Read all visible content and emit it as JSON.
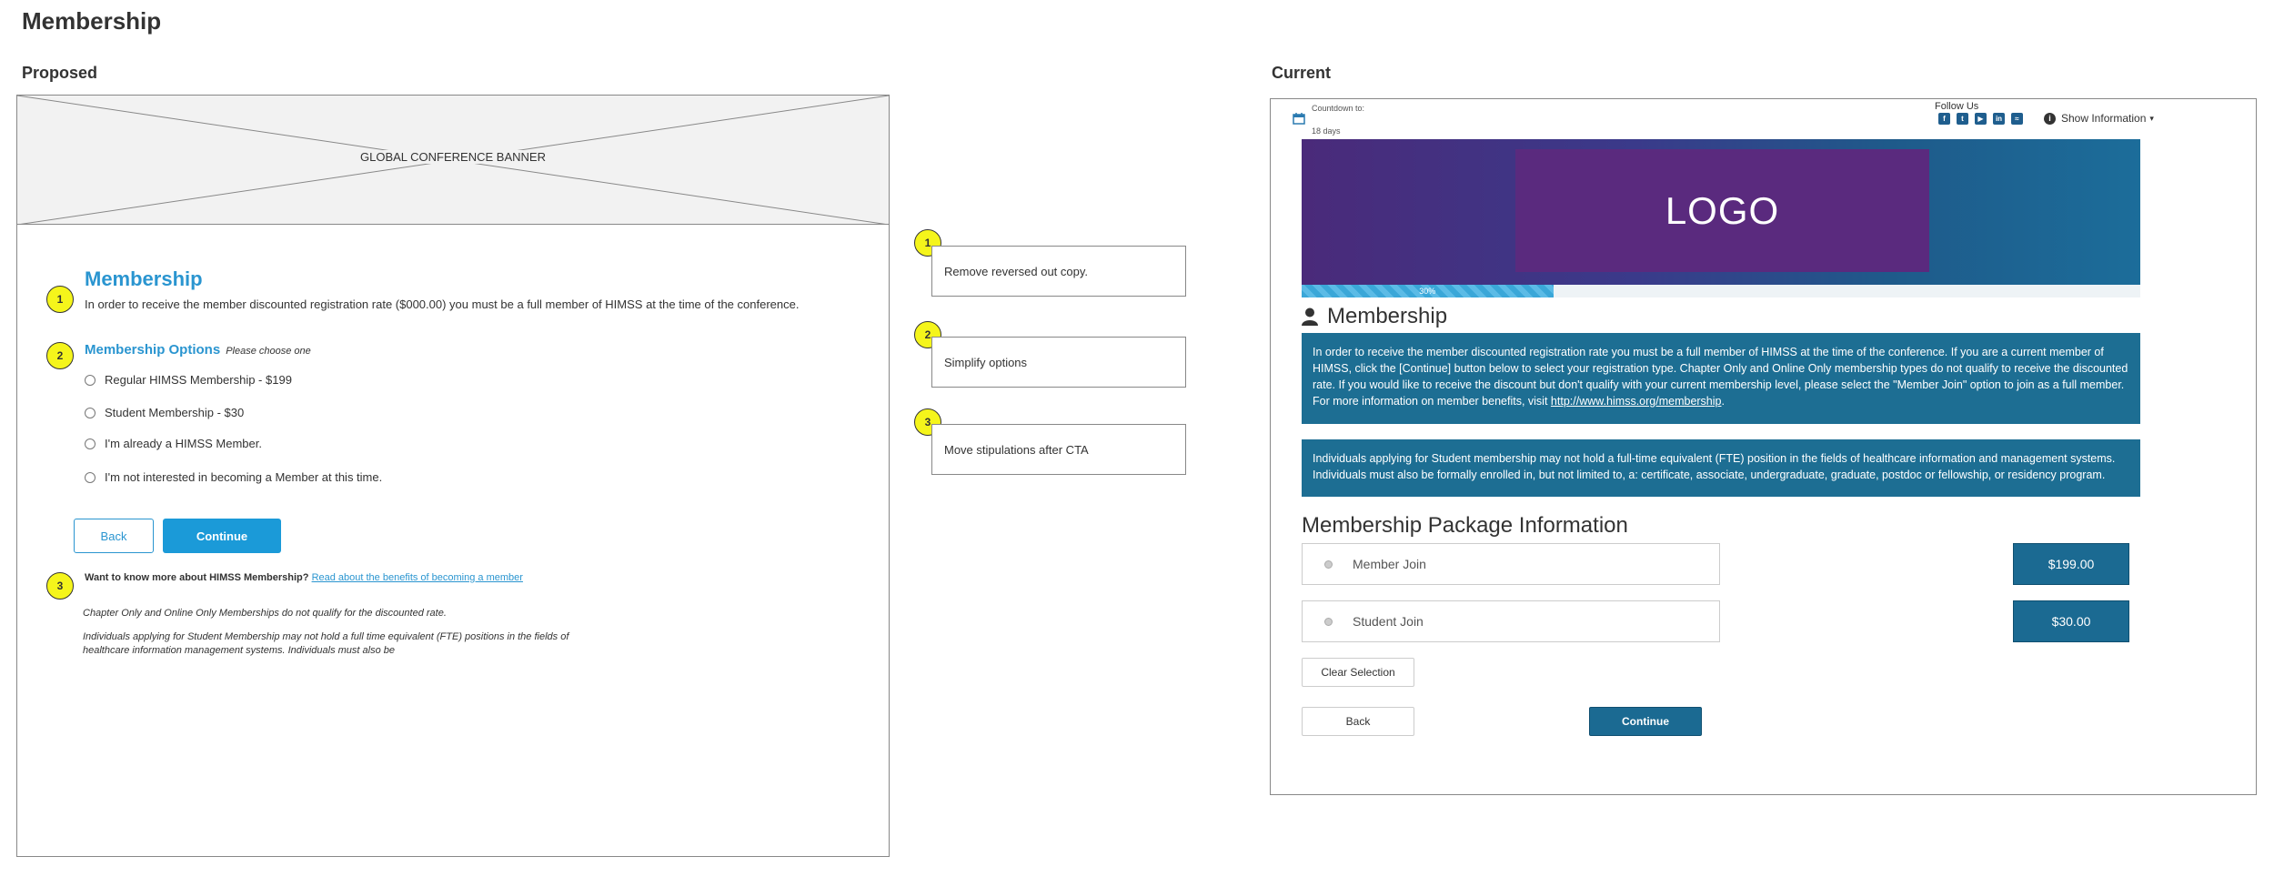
{
  "page": {
    "title": "Membership"
  },
  "proposed": {
    "section_title": "Proposed",
    "banner_label": "GLOBAL CONFERENCE BANNER",
    "badge1": "1",
    "badge2": "2",
    "badge3": "3",
    "heading": "Membership",
    "intro": "In order to receive the member discounted registration rate ($000.00) you must be a full member of HIMSS at the time of the conference.",
    "options_title": "Membership Options",
    "options_hint": "Please choose one",
    "options": [
      "Regular HIMSS Membership - $199",
      "Student Membership - $30",
      "I'm already a HIMSS Member.",
      "I'm not interested in becoming a Member at this time."
    ],
    "back_label": "Back",
    "continue_label": "Continue",
    "learn_more_bold": "Want to know more about HIMSS Membership?",
    "learn_more_link": "Read about the benefits of becoming a member",
    "stipulation1": "Chapter Only and Online Only Memberships do not qualify for the discounted rate.",
    "stipulation2": "Individuals applying for Student Membership may not hold a full time equivalent (FTE) positions in the fields of healthcare information management systems. Individuals must also be"
  },
  "notes": [
    {
      "number": "1",
      "text": "Remove reversed out copy."
    },
    {
      "number": "2",
      "text": "Simplify options"
    },
    {
      "number": "3",
      "text": "Move stipulations after CTA"
    }
  ],
  "current": {
    "section_title": "Current",
    "countdown_label": "Countdown to:",
    "countdown_value": "18 days",
    "follow_label": "Follow Us",
    "social_icons": [
      "facebook-icon",
      "twitter-icon",
      "youtube-icon",
      "linkedin-icon",
      "rss-icon"
    ],
    "social_glyphs": [
      "f",
      "t",
      "▶",
      "in",
      "≈"
    ],
    "show_info": "Show Information",
    "logo": "LOGO",
    "progress": {
      "label": "30%",
      "value": 30
    },
    "heading": "Membership",
    "info1": "In order to receive the member discounted registration rate you must be a full member of HIMSS at the time of the conference. If you are a current member of HIMSS, click the [Continue] button below to select your registration type. Chapter Only and Online Only membership types do not qualify to receive the discounted rate. If you would like to receive the discount but don't qualify with your current membership level, please select the \"Member Join\" option to join as a full member. For more information on member benefits, visit",
    "info1_link": "http://www.himss.org/membership",
    "info2": "Individuals applying for Student membership may not hold a full-time equivalent (FTE) position in the fields of healthcare information and management systems. Individuals must also be formally enrolled in, but not limited to, a: certificate, associate, undergraduate, graduate, postdoc or fellowship, or residency program.",
    "package_heading": "Membership Package Information",
    "packages": [
      {
        "label": "Member Join",
        "price": "$199.00"
      },
      {
        "label": "Student Join",
        "price": "$30.00"
      }
    ],
    "clear_label": "Clear Selection",
    "back_label": "Back",
    "continue_label": "Continue"
  },
  "colors": {
    "accent": "#2a95d0",
    "badge": "#f5f51b",
    "current_primary": "#1b6a92"
  }
}
